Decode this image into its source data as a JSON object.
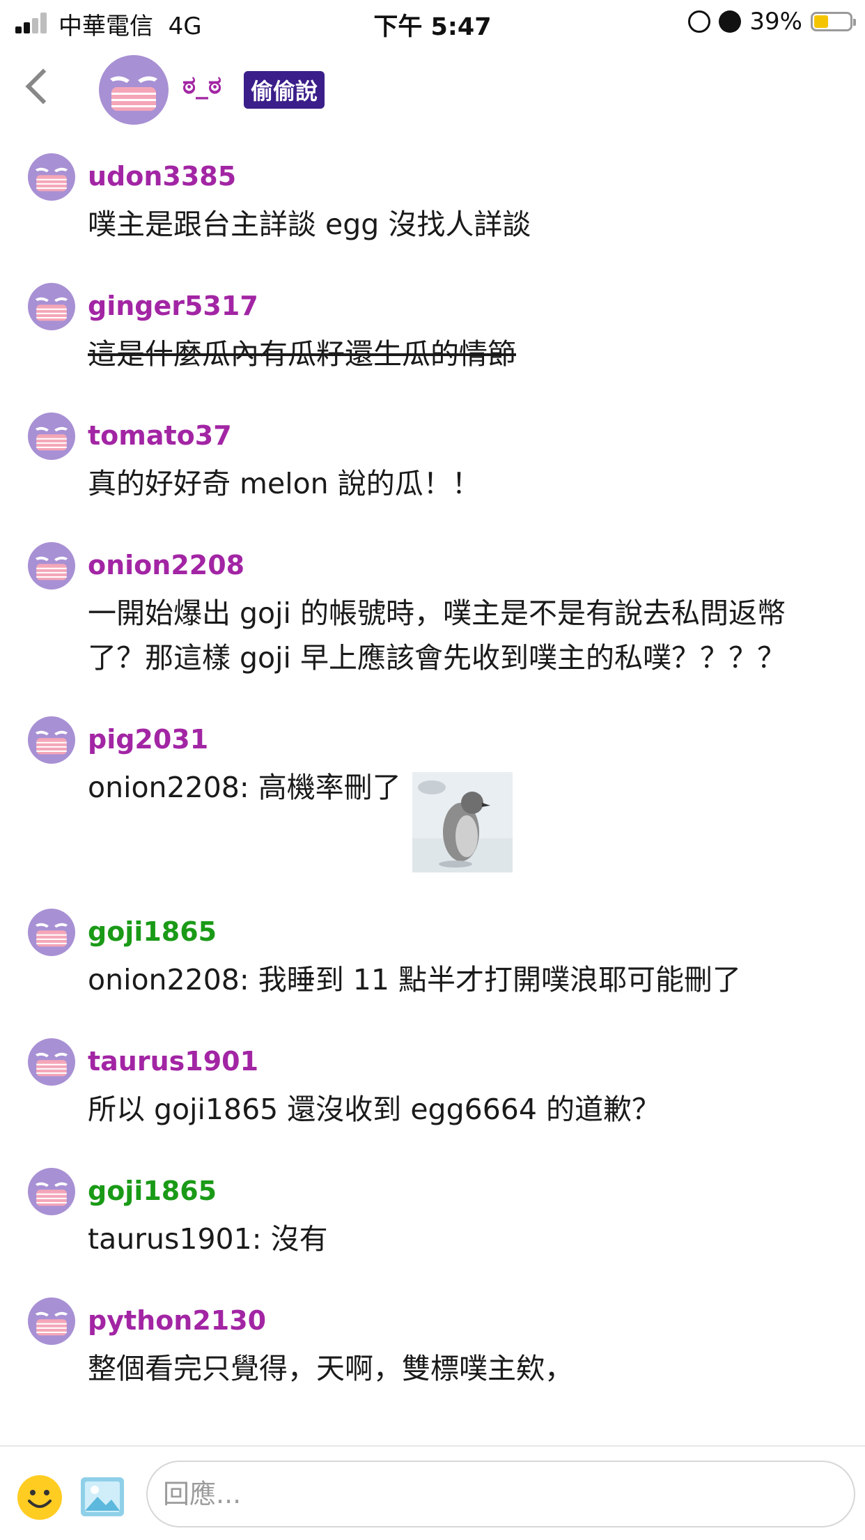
{
  "status_bar": {
    "carrier": "中華電信",
    "network": "4G",
    "time": "下午 5:47",
    "battery_percent": "39%",
    "battery_level": 0.39,
    "icons": [
      "signal-icon",
      "orientation-lock-icon",
      "alarm-icon",
      "battery-icon"
    ]
  },
  "header": {
    "author": "ಠ_ಠ",
    "tag": "偷偷說",
    "back_icon": "chevron-left-icon"
  },
  "colors": {
    "purple_name": "#a225a4",
    "green_name": "#1a9a17",
    "tag_bg": "#3b1e8a",
    "avatar_bg": "#a890d4",
    "mask_pink": "#f4a6b8",
    "battery_yellow": "#f5c400"
  },
  "responses": [
    {
      "name": "udon3385",
      "name_color": "#a225a4",
      "text": "噗主是跟台主詳談 egg 沒找人詳談"
    },
    {
      "name": "ginger5317",
      "name_color": "#a225a4",
      "text": "這是什麼瓜內有瓜籽還生瓜的情節",
      "strikethrough": true
    },
    {
      "name": "tomato37",
      "name_color": "#a225a4",
      "text": "真的好好奇 melon 說的瓜！！"
    },
    {
      "name": "onion2208",
      "name_color": "#a225a4",
      "text": "一開始爆出 goji 的帳號時，噗主是不是有說去私問返幣了？那這樣 goji 早上應該會先收到噗主的私噗？？？？"
    },
    {
      "name": "pig2031",
      "name_color": "#a225a4",
      "text": "onion2208: 高機率刪了",
      "has_image": true,
      "image_icon": "penguin-image"
    },
    {
      "name": "goji1865",
      "name_color": "#1a9a17",
      "text": "onion2208: 我睡到 11 點半才打開噗浪耶可能刪了"
    },
    {
      "name": "taurus1901",
      "name_color": "#a225a4",
      "text": "所以 goji1865 還沒收到 egg6664 的道歉？"
    },
    {
      "name": "goji1865",
      "name_color": "#1a9a17",
      "text": "taurus1901: 沒有"
    },
    {
      "name": "python2130",
      "name_color": "#a225a4",
      "text": "整個看完只覺得，天啊，雙標噗主欸，"
    }
  ],
  "reply_bar": {
    "placeholder": "回應...",
    "emoji_icon": "emoji-icon",
    "image_icon": "image-upload-icon"
  }
}
